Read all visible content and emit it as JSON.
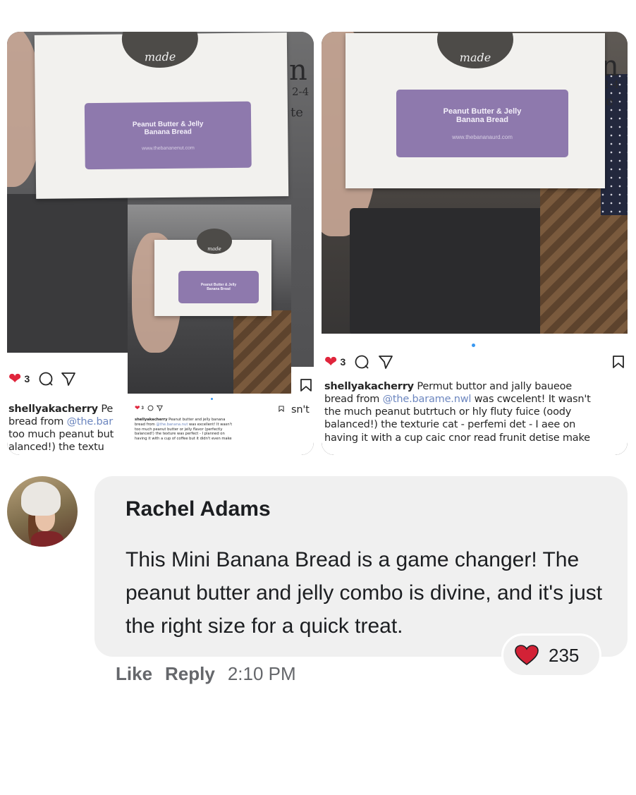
{
  "photos": {
    "card_logo": "made",
    "card_label_line1": "Peanut Butter & Jelly",
    "card_label_line2": "Banana Bread",
    "card_label_url_left": "www.thebananenut.com",
    "card_label_url_right": "www.thebananaurd.com",
    "edge_text_1": "n",
    "edge_text_2": "2-4",
    "edge_text_3": "te"
  },
  "left_post": {
    "likes": "3",
    "username": "shellyakacherry",
    "line1_rest": " Pe",
    "line2_prefix": "bread from ",
    "line2_mention": "@the.bar",
    "line3": "too much peanut but",
    "line4": "alanced!) the textu",
    "overflow_text": "sn't",
    "inset": {
      "likes": "3",
      "username": "shellyakacherry",
      "line1_rest": " Peanut butter and jelly banana",
      "line2_prefix": "bread from ",
      "line2_mention": "@the.banana.nut",
      "line2_suffix": " was excellent! It wasn't",
      "line3": "too much peanut butter or jelly flavor (perfectly",
      "line4": "balanced!) the texture was perfect - I planned on",
      "line5": "having it with a cup of coffee but it didn't even make"
    }
  },
  "right_post": {
    "likes": "3",
    "username": "shellyakacherry",
    "line1_rest": " Permut buttor and jally baueoe",
    "line2_prefix": "bread from ",
    "line2_mention": "@the.barame.nwl",
    "line2_suffix": " was cwcelent! It wasn't",
    "line3": "the much peanut butrtuch or hly fluty fuice (oody",
    "line4": "balanced!) the texturie cat - perfemi det - I aee on",
    "line5": "having it with a cup caic cnor read frunit detise make"
  },
  "comment": {
    "author": "Rachel Adams",
    "text": "This Mini Banana Bread is a game changer! The peanut butter and jelly combo is divine, and it's just the right size for a quick treat.",
    "reaction_count": "235",
    "like_label": "Like",
    "reply_label": "Reply",
    "time": "2:10 PM"
  },
  "colors": {
    "heart": "#e0253c",
    "reaction_heart": "#d32236",
    "mention": "#6c86bf",
    "label_purple": "#8e79ad",
    "bubble_bg": "#f0f0f0",
    "meta_text": "#65676b"
  }
}
